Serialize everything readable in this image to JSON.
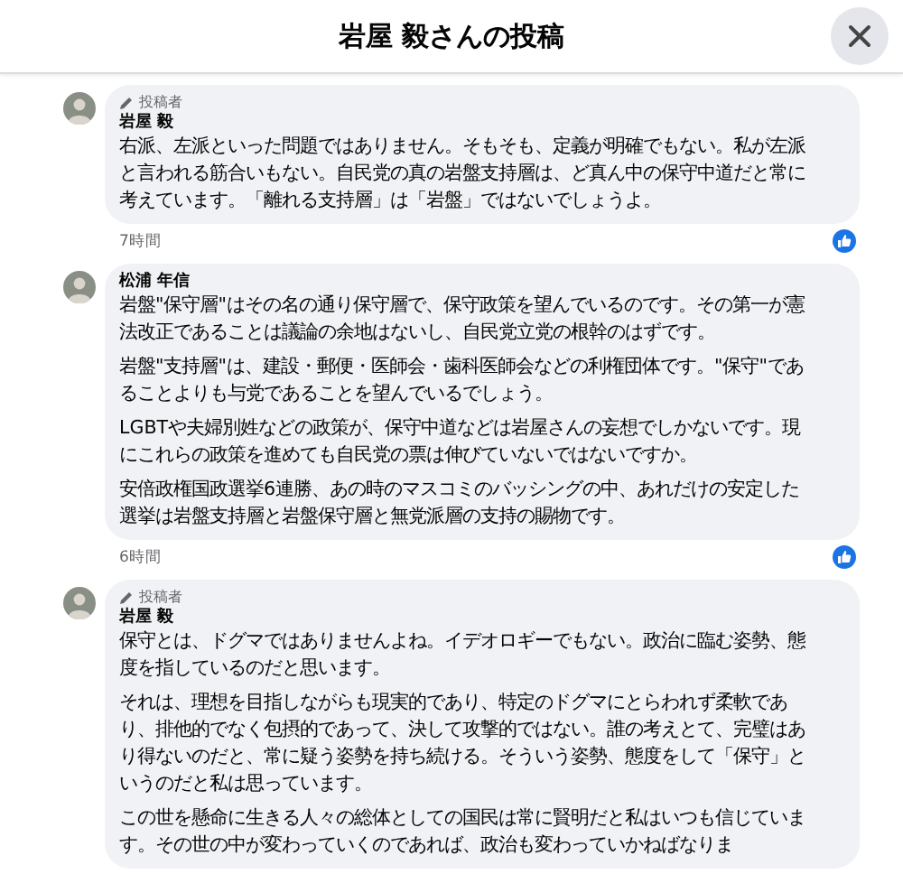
{
  "header": {
    "title": "岩屋 毅さんの投稿"
  },
  "comments": [
    {
      "badge": "投稿者",
      "author": "岩屋 毅",
      "paragraphs": [
        "右派、左派といった問題ではありません。そもそも、定義が明確でもない。私が左派と言われる筋合いもない。自民党の真の岩盤支持層は、ど真ん中の保守中道だと常に考えています。「離れる支持層」は「岩盤」ではないでしょうよ。"
      ],
      "time": "7時間",
      "liked": true
    },
    {
      "author": "松浦 年信",
      "paragraphs": [
        "岩盤\"保守層\"はその名の通り保守層で、保守政策を望んでいるのです。その第一が憲法改正であることは議論の余地はないし、自民党立党の根幹のはずです。",
        "岩盤\"支持層\"は、建設・郵便・医師会・歯科医師会などの利権団体です。\"保守\"であることよりも与党であることを望んでいるでしょう。",
        "LGBTや夫婦別姓などの政策が、保守中道などは岩屋さんの妄想でしかないです。現にこれらの政策を進めても自民党の票は伸びていないではないですか。",
        "安倍政権国政選挙6連勝、あの時のマスコミのバッシングの中、あれだけの安定した選挙は岩盤支持層と岩盤保守層と無党派層の支持の賜物です。"
      ],
      "time": "6時間",
      "liked": true
    },
    {
      "badge": "投稿者",
      "author": "岩屋 毅",
      "paragraphs": [
        "保守とは、ドグマではありませんよね。イデオロギーでもない。政治に臨む姿勢、態度を指しているのだと思います。",
        "それは、理想を目指しながらも現実的であり、特定のドグマにとらわれず柔軟であり、排他的でなく包摂的であって、決して攻撃的ではない。誰の考えとて、完璧はあり得ないのだと、常に疑う姿勢を持ち続ける。そういう姿勢、態度をして「保守」というのだと私は思っています。",
        "この世を懸命に生きる人々の総体としての国民は常に賢明だと私はいつも信じています。その世の中が変わっていくのであれば、政治も変わっていかねばなりま"
      ]
    }
  ]
}
